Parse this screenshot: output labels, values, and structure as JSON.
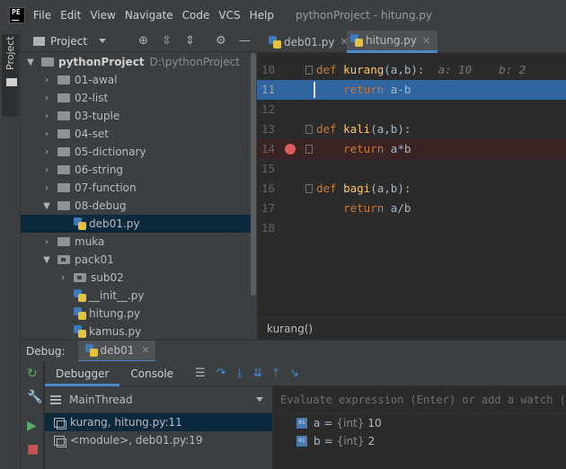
{
  "menu": {
    "logo_text": "PE",
    "items": [
      "File",
      "Edit",
      "View",
      "Navigate",
      "Code",
      "VCS",
      "Help"
    ],
    "window_title": "pythonProject - hitung.py"
  },
  "side_strip": {
    "project_label": "Project"
  },
  "project_panel": {
    "title": "Project",
    "root": {
      "name": "pythonProject",
      "path": "D:\\pythonProject"
    },
    "items": [
      "01-awal",
      "02-list",
      "03-tuple",
      "04-set",
      "05-dictionary",
      "06-string",
      "07-function",
      "08-debug",
      "deb01.py",
      "muka",
      "pack01",
      "sub02",
      "__init__.py",
      "hitung.py",
      "kamus.py"
    ]
  },
  "editor": {
    "tabs": [
      "deb01.py",
      "hitung.py"
    ],
    "active_tab": "hitung.py",
    "lines": [
      {
        "num": "10",
        "kw": "def ",
        "fn": "kurang",
        "rest": "(a,b):",
        "hint": "  a: 10    b: 2"
      },
      {
        "num": "11",
        "kw": "    return",
        "rest": " a-b"
      },
      {
        "num": "12"
      },
      {
        "num": "13",
        "kw": "def ",
        "fn": "kali",
        "rest": "(a,b):"
      },
      {
        "num": "14",
        "kw": "    return",
        "rest": " a*b"
      },
      {
        "num": "15"
      },
      {
        "num": "16",
        "kw": "def ",
        "fn": "bagi",
        "rest": "(a,b):"
      },
      {
        "num": "17",
        "kw": "    return",
        "rest": " a/b"
      },
      {
        "num": "18"
      }
    ],
    "breadcrumb": "kurang()"
  },
  "debug": {
    "label": "Debug:",
    "session": "deb01",
    "tabs": {
      "debugger": "Debugger",
      "console": "Console"
    },
    "thread": "MainThread",
    "frames": [
      "kurang, hitung.py:11",
      "<module>, deb01.py:19"
    ],
    "eval_placeholder": "Evaluate expression (Enter) or add a watch (Ctrl",
    "variables": [
      {
        "icon": "01",
        "name": "a",
        "type": "{int}",
        "value": "10"
      },
      {
        "icon": "01",
        "name": "b",
        "type": "{int}",
        "value": "2"
      }
    ]
  }
}
